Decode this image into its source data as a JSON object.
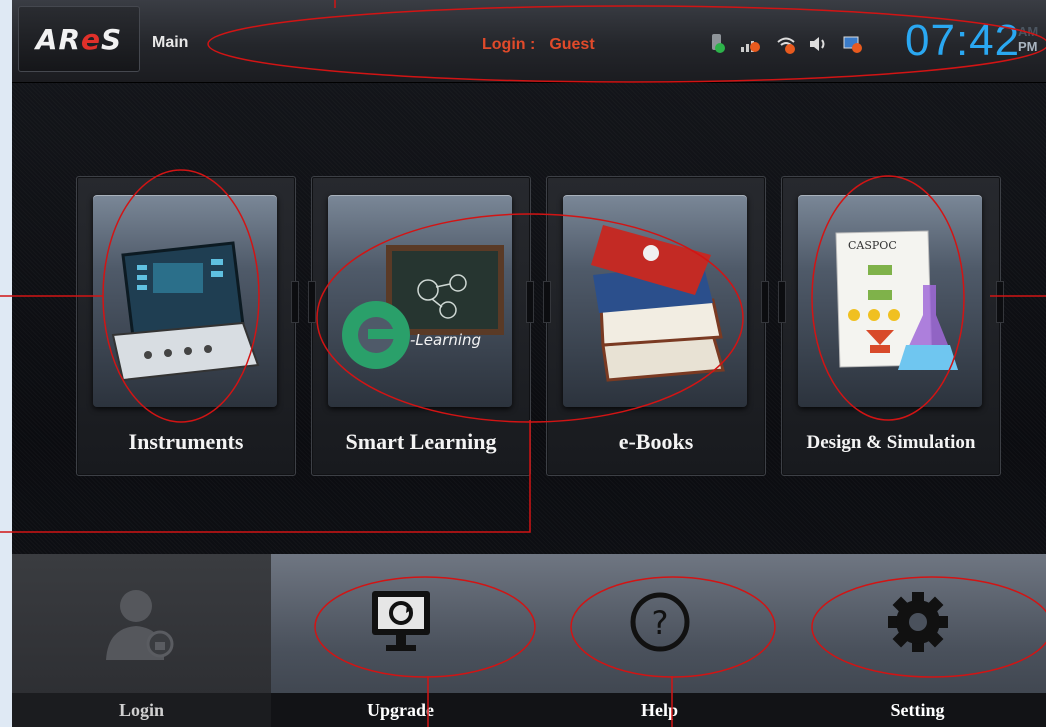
{
  "header": {
    "logo_text": "AR",
    "logo_e": "e",
    "logo_s": "S",
    "main_label": "Main",
    "login_prefix": "Login :",
    "login_user": "Guest",
    "status_icons": [
      "usb-icon",
      "signal-icon",
      "wifi-icon",
      "volume-icon",
      "network-icon"
    ],
    "clock": "07:42",
    "am": "AM",
    "pm": "PM"
  },
  "tiles": [
    {
      "label": "Instruments",
      "icon": "instrument-device-icon"
    },
    {
      "label": "Smart Learning",
      "icon": "e-learning-icon",
      "pic_text": "-Learning"
    },
    {
      "label": "e-Books",
      "icon": "books-icon"
    },
    {
      "label": "Design & Simulation",
      "icon": "caspoc-flask-icon",
      "pic_text": "CASPOC"
    }
  ],
  "bottom": [
    {
      "label": "Login",
      "icon": "user-lock-icon"
    },
    {
      "label": "Upgrade",
      "icon": "monitor-update-icon"
    },
    {
      "label": "Help",
      "icon": "question-icon"
    },
    {
      "label": "Setting",
      "icon": "gear-icon"
    }
  ],
  "colors": {
    "accent_blue": "#2aa8f2",
    "login_red": "#e04a2a",
    "annotation_red": "#d21414"
  }
}
